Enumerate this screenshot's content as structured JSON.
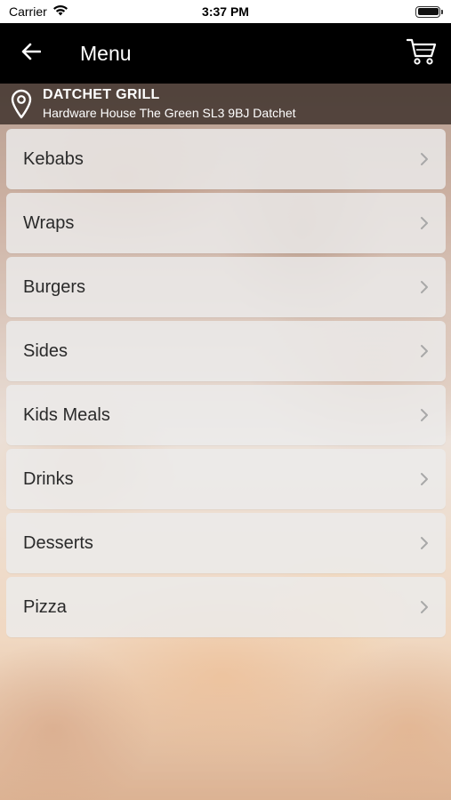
{
  "status_bar": {
    "carrier": "Carrier",
    "time": "3:37 PM"
  },
  "nav": {
    "title": "Menu",
    "back_icon": "arrow-left-icon",
    "cart_icon": "cart-icon"
  },
  "location": {
    "name": "DATCHET GRILL",
    "address": "Hardware House The Green SL3 9BJ Datchet",
    "icon": "map-pin-icon"
  },
  "menu": {
    "items": [
      {
        "label": "Kebabs"
      },
      {
        "label": "Wraps"
      },
      {
        "label": "Burgers"
      },
      {
        "label": "Sides"
      },
      {
        "label": "Kids Meals"
      },
      {
        "label": "Drinks"
      },
      {
        "label": "Desserts"
      },
      {
        "label": "Pizza"
      }
    ]
  },
  "colors": {
    "nav_background": "#000000",
    "item_background": "#ebebeb",
    "text": "#2a2a2a"
  }
}
